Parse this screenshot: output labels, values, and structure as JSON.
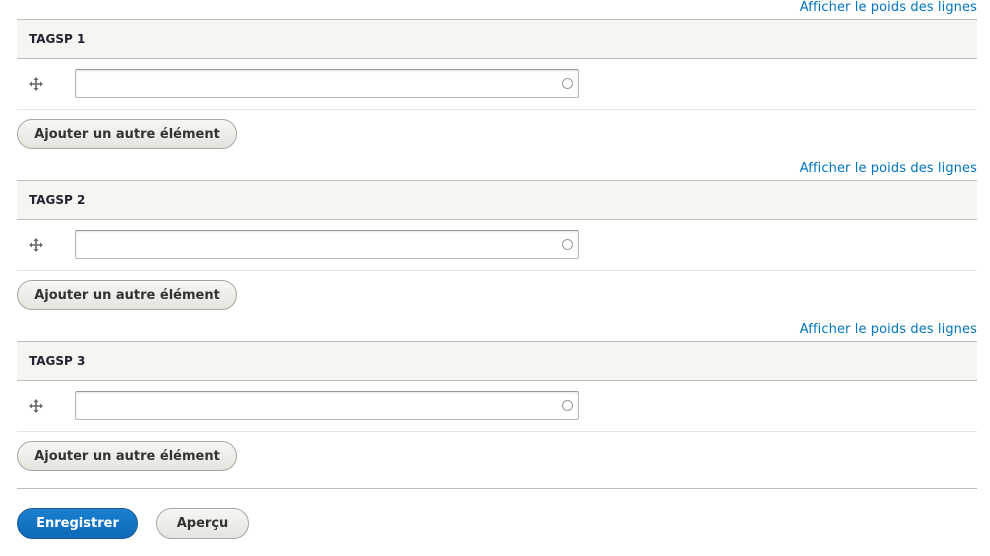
{
  "groups": [
    {
      "weights_link": "Afficher le poids des lignes",
      "header": "TAGSP 1",
      "field_value": "",
      "add_button": "Ajouter un autre élément"
    },
    {
      "weights_link": "Afficher le poids des lignes",
      "header": "TAGSP 2",
      "field_value": "",
      "add_button": "Ajouter un autre élément"
    },
    {
      "weights_link": "Afficher le poids des lignes",
      "header": "TAGSP 3",
      "field_value": "",
      "add_button": "Ajouter un autre élément"
    }
  ],
  "actions": {
    "save_label": "Enregistrer",
    "preview_label": "Aperçu"
  },
  "colors": {
    "link": "#0074bd",
    "primary_button": "#0e69b8",
    "header_bg": "#f5f5f2"
  },
  "icons": {
    "drag_handle": "move-arrows-icon",
    "autocomplete": "autocomplete-throbber-icon"
  }
}
